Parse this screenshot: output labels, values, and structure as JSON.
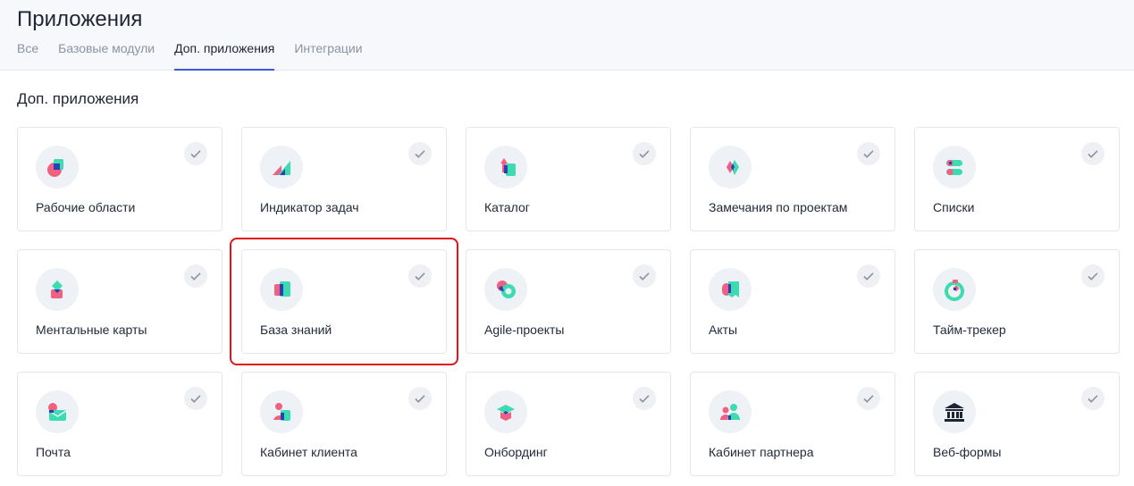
{
  "header": {
    "title": "Приложения",
    "tabs": [
      {
        "label": "Все",
        "active": false
      },
      {
        "label": "Базовые модули",
        "active": false
      },
      {
        "label": "Доп. приложения",
        "active": true
      },
      {
        "label": "Интеграции",
        "active": false
      }
    ]
  },
  "section_title": "Доп. приложения",
  "cards": [
    {
      "label": "Рабочие области",
      "icon": "workspaces-icon",
      "installed": true
    },
    {
      "label": "Индикатор задач",
      "icon": "task-indicator-icon",
      "installed": true
    },
    {
      "label": "Каталог",
      "icon": "catalog-icon",
      "installed": true
    },
    {
      "label": "Замечания по проектам",
      "icon": "project-remarks-icon",
      "installed": true
    },
    {
      "label": "Списки",
      "icon": "lists-icon",
      "installed": true
    },
    {
      "label": "Ментальные карты",
      "icon": "mind-maps-icon",
      "installed": true
    },
    {
      "label": "База знаний",
      "icon": "knowledge-base-icon",
      "installed": true,
      "highlighted": true
    },
    {
      "label": "Agile-проекты",
      "icon": "agile-projects-icon",
      "installed": true
    },
    {
      "label": "Акты",
      "icon": "acts-icon",
      "installed": true
    },
    {
      "label": "Тайм-трекер",
      "icon": "time-tracker-icon",
      "installed": true
    },
    {
      "label": "Почта",
      "icon": "mail-icon",
      "installed": true
    },
    {
      "label": "Кабинет клиента",
      "icon": "client-cabinet-icon",
      "installed": true
    },
    {
      "label": "Онбординг",
      "icon": "onboarding-icon",
      "installed": true
    },
    {
      "label": "Кабинет партнера",
      "icon": "partner-cabinet-icon",
      "installed": true
    },
    {
      "label": "Веб-формы",
      "icon": "web-forms-icon",
      "installed": true
    }
  ],
  "colors": {
    "accent": "#3b5bdb",
    "pink": "#f0607f",
    "teal": "#3ddbb1",
    "navy": "#2e3fb5",
    "highlight": "#e0141b"
  }
}
